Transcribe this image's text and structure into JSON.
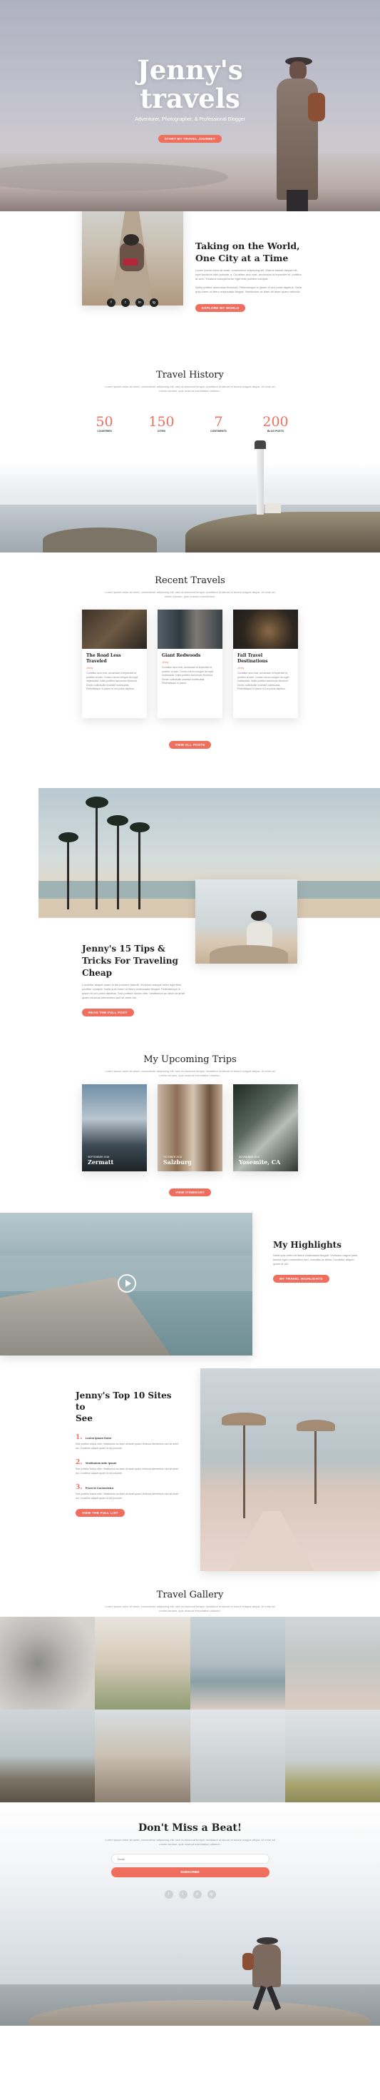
{
  "hero": {
    "title_line1": "Jenny's",
    "title_line2": "travels",
    "subtitle": "Adventurer, Photographer, & Professional Blogger",
    "button": "Start My Travel Journey"
  },
  "about": {
    "title_line1": "Taking on the World,",
    "title_line2": "One City at a Time",
    "para1": "Lorem ipsum dolor sit amet, consectetur adipiscing elit. Mauris blandit aliquet elit, eget tincidunt nibh pulvinar a. Curabitur arcu erat, accumsan id imperdiet et, porttitor at sem. Vivamus suscipit tortor eget felis porttitor volutpat.",
    "para2": "Nulla porttitor accumsan tincidunt. Pellentesque in ipsum id orci porta dapibus. Nulla quis lorem ut libero malesuada feugiat. Vestibulum ac diam sit amet quam vehicula.",
    "button": "Explore My World",
    "social": [
      "f",
      "t",
      "in",
      "ig"
    ]
  },
  "history": {
    "title": "Travel History",
    "lead": "Lorem ipsum dolor sit amet, consectetur adipiscing elit, sed do eiusmod tempor incididunt ut labore et dolore magna aliqua. Ut enim ad minim veniam, quis nostrud exercitation ullamco.",
    "stats": [
      {
        "value": "50",
        "label": "Countries"
      },
      {
        "value": "150",
        "label": "Cities"
      },
      {
        "value": "7",
        "label": "Continents"
      },
      {
        "value": "200",
        "label": "Blog Posts"
      }
    ]
  },
  "recent": {
    "title": "Recent Travels",
    "lead": "Lorem ipsum dolor sit amet, consectetur adipiscing elit, sed do eiusmod tempor incididunt ut labore et dolore magna aliqua. Ut enim ad minim veniam, quis nostrud exercitation.",
    "posts": [
      {
        "title": "The Road Less Traveled",
        "meta": "Jenny",
        "body": "Curabitur arcu erat, accumsan id imperdiet et, porttitor at sem. Donec rutrum congue leo eget malesuada. Nulla porttitor accumsan tincidunt. Donec sollicitudin molestie malesuada. Pellentesque in ipsum id orci porta dapibus."
      },
      {
        "title": "Giant Redwoods",
        "meta": "Jenny",
        "body": "Curabitur arcu erat, accumsan id imperdiet et, porttitor at sem. Donec rutrum congue leo eget malesuada. Nulla porttitor accumsan tincidunt. Donec sollicitudin molestie malesuada. Pellentesque in ipsum."
      },
      {
        "title": "Fall Travel Destinations",
        "meta": "Jenny",
        "body": "Curabitur arcu erat, accumsan id imperdiet et, porttitor at sem. Donec rutrum congue leo eget malesuada. Nulla porttitor accumsan tincidunt. Donec sollicitudin molestie malesuada. Pellentesque in ipsum id orci porta dapibus."
      }
    ],
    "button": "View All Posts"
  },
  "tips": {
    "title_line1": "Jenny's 15 Tips &",
    "title_line2": "Tricks For Traveling",
    "title_line3": "Cheap",
    "body": "Curabitur aliquet quam id dui posuere blandit. Vivamus suscipit tortor eget felis porttitor volutpat. Nulla quis lorem ut libero malesuada feugiat. Pellentesque in ipsum id orci porta dapibus. Sed porttitor lectus nibh. Vestibulum ac diam sit amet quam vehicula elementum sed sit amet dui.",
    "button": "Read The Full Post"
  },
  "trips": {
    "title": "My Upcoming Trips",
    "lead": "Lorem ipsum dolor sit amet, consectetur adipiscing elit, sed do eiusmod tempor incididunt ut labore et dolore magna aliqua. Ut enim ad minim veniam, quis nostrud exercitation ullamco.",
    "items": [
      {
        "date": "September 2018",
        "city": "Zermatt"
      },
      {
        "date": "October 2018",
        "city": "Salzburg"
      },
      {
        "date": "November 2018",
        "city": "Yosemite, CA"
      }
    ],
    "button": "View Itinerary"
  },
  "highlights": {
    "title": "My Highlights",
    "body": "Nulla quis lorem ut libero malesuada feugiat. Vivamus magna justo, lacinia eget consectetur sed, convallis at tellus. Curabitur aliquet quam id dui.",
    "button": "My Travel Highlights"
  },
  "top10": {
    "title_line1": "Jenny's Top 10 Sites to",
    "title_line2": "See",
    "items": [
      {
        "num": "1.",
        "title": "Lorem Ipsum Dolor",
        "body": "Sed porttitor lectus nibh. Vestibulum ac diam sit amet quam vehicula elementum sed sit amet dui. Curabitur aliquet quam id dui posuere."
      },
      {
        "num": "2.",
        "title": "Vestibulum ante ipsum",
        "body": "Sed porttitor lectus nibh. Vestibulum ac diam sit amet quam vehicula elementum sed sit amet dui. Curabitur aliquet quam id dui posuere."
      },
      {
        "num": "3.",
        "title": "Proin Id Consectetur",
        "body": "Sed porttitor lectus nibh. Vestibulum ac diam sit amet quam vehicula elementum sed sit amet dui. Curabitur aliquet quam id dui posuere."
      }
    ],
    "button": "View the Full List"
  },
  "gallery": {
    "title": "Travel Gallery",
    "lead": "Lorem ipsum dolor sit amet, consectetur adipiscing elit, sed do eiusmod tempor incididunt ut labore et dolore magna aliqua. Ut enim ad minim veniam, quis nostrud exercitation ullamco."
  },
  "newsletter": {
    "title": "Don't Miss a Beat!",
    "lead": "Lorem ipsum dolor sit amet, consectetur adipiscing elit, sed do eiusmod tempor incididunt ut labore et dolore magna aliqua. Ut enim ad minim veniam, quis nostrud exercitation ullamco.",
    "placeholder": "Email",
    "button": "Subscribe",
    "social": [
      "f",
      "t",
      "in",
      "ig"
    ]
  },
  "colors": {
    "accent": "#ef6e5e",
    "dark": "#222222"
  }
}
